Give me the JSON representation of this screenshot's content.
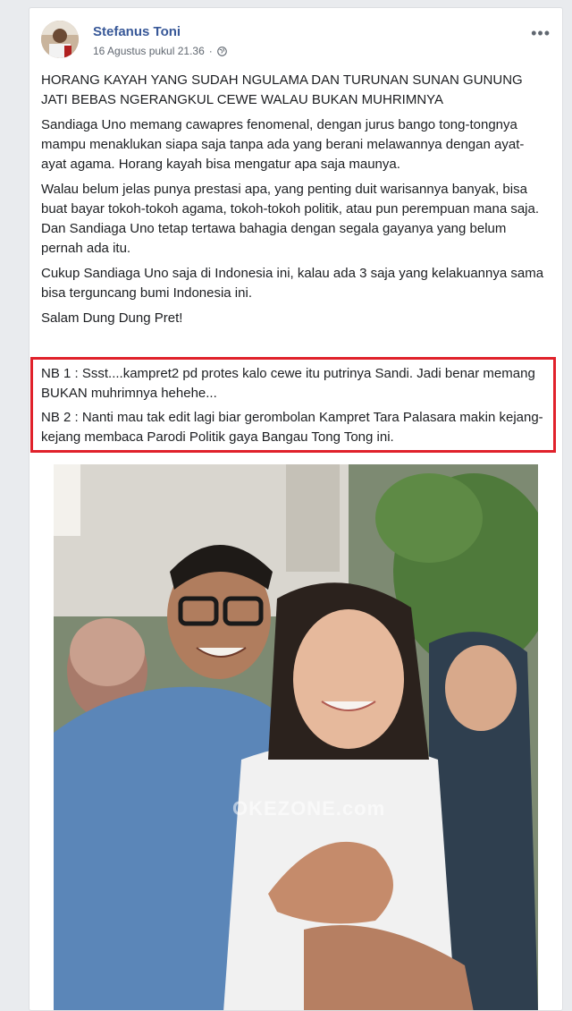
{
  "post": {
    "author": "Stefanus Toni",
    "timestamp": "16 Agustus pukul 21.36",
    "privacy_icon": "globe-icon",
    "more_icon": "more-options-icon",
    "more_label": "•••",
    "paragraphs": [
      "HORANG KAYAH YANG SUDAH NGULAMA DAN TURUNAN SUNAN GUNUNG JATI BEBAS NGERANGKUL CEWE WALAU BUKAN MUHRIMNYA",
      "Sandiaga Uno memang cawapres fenomenal, dengan jurus bango tong-tongnya mampu menaklukan siapa saja tanpa ada yang berani melawannya dengan ayat-ayat agama. Horang kayah bisa mengatur apa saja maunya.",
      "Walau belum jelas punya prestasi apa, yang penting duit warisannya banyak, bisa buat bayar tokoh-tokoh agama, tokoh-tokoh politik, atau pun perempuan mana saja. Dan Sandiaga Uno tetap tertawa bahagia dengan segala gayanya yang belum pernah ada itu.",
      "Cukup Sandiaga Uno saja di Indonesia ini, kalau ada 3 saja yang kelakuannya sama bisa terguncang bumi Indonesia ini.",
      "Salam Dung Dung Pret!"
    ],
    "nb1": "NB 1 : Ssst....kampret2 pd protes kalo cewe itu putrinya Sandi. Jadi benar memang BUKAN muhrimnya hehehe...",
    "nb2": "NB 2 : Nanti mau tak edit lagi biar gerombolan Kampret Tara Palasara makin kejang-kejang membaca Parodi Politik gaya Bangau Tong Tong ini.",
    "highlight_color": "#e0212b",
    "photo_watermark": "OKEZONE.com"
  }
}
